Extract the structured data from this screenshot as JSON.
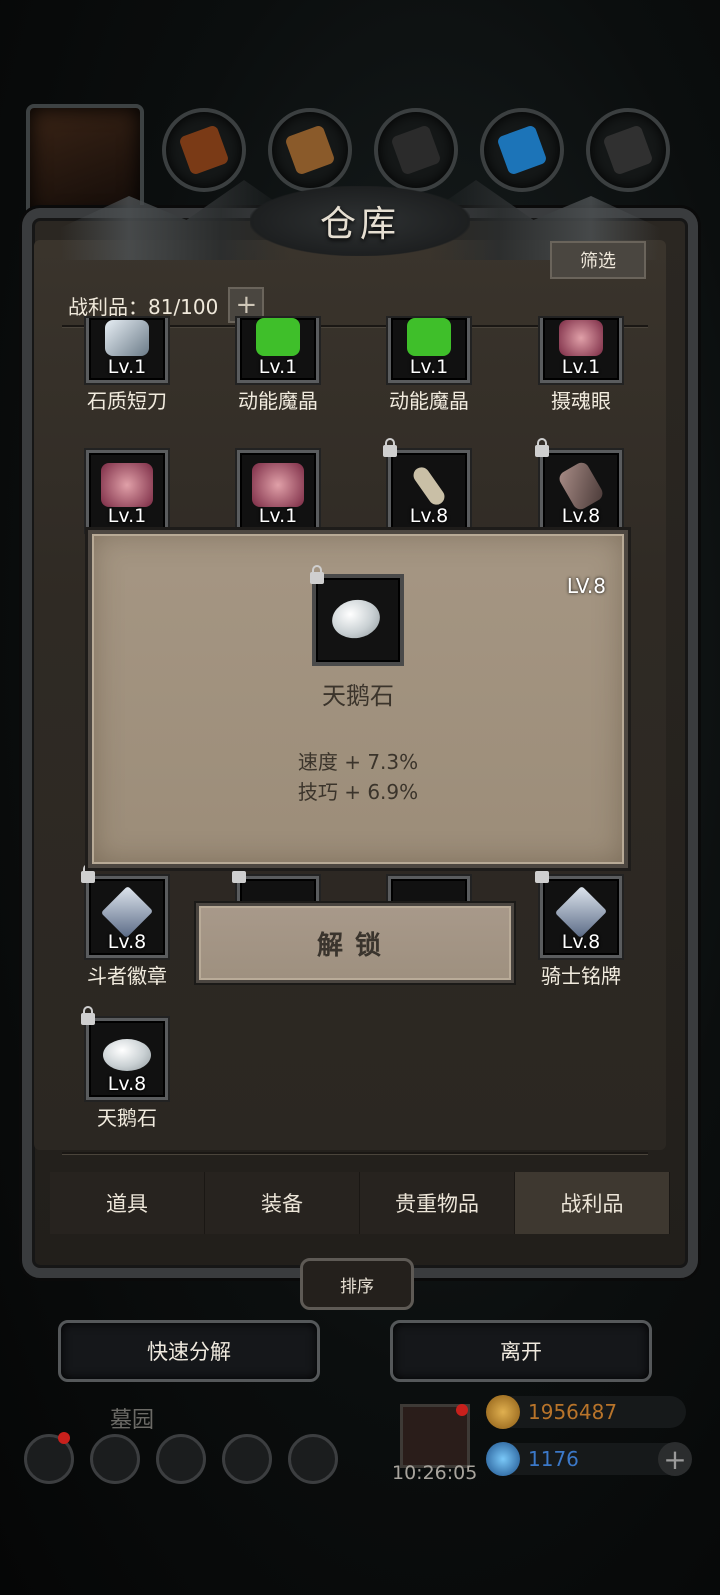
{
  "window": {
    "title": "仓库"
  },
  "header": {
    "filter_label": "筛选",
    "loot_label": "战利品：81/100",
    "plus_symbol": "+"
  },
  "grid": {
    "row1": [
      {
        "level": "Lv.1",
        "name": "石质短刀",
        "locked": false,
        "icon": "blade-icon"
      },
      {
        "level": "Lv.1",
        "name": "动能魔晶",
        "locked": false,
        "icon": "green-crystal-icon"
      },
      {
        "level": "Lv.1",
        "name": "动能魔晶",
        "locked": false,
        "icon": "green-crystal-icon"
      },
      {
        "level": "Lv.1",
        "name": "摄魂眼",
        "locked": false,
        "icon": "eye-icon"
      }
    ],
    "row2": [
      {
        "level": "Lv.1",
        "locked": false,
        "icon": "eye-icon"
      },
      {
        "level": "Lv.1",
        "locked": false,
        "icon": "eye-icon"
      },
      {
        "level": "Lv.8",
        "locked": true,
        "icon": "bone-icon"
      },
      {
        "level": "Lv.8",
        "locked": true,
        "icon": "shard-icon"
      }
    ],
    "row5": [
      {
        "level": "Lv.8",
        "name": "斗者徽章",
        "locked": true,
        "icon": "badge-icon"
      },
      {
        "level": "Lv.8",
        "name": "骑士铭牌",
        "locked": true,
        "icon": "badge-icon"
      }
    ],
    "row6": [
      {
        "level": "Lv.8",
        "name": "天鹅石",
        "locked": true,
        "icon": "stone-icon"
      }
    ]
  },
  "popup": {
    "level": "LV.8",
    "name": "天鹅石",
    "stats": [
      "速度 + 7.3%",
      "技巧 + 6.9%"
    ],
    "unlock_label": "解锁"
  },
  "tabs": [
    {
      "label": "道具",
      "active": false
    },
    {
      "label": "装备",
      "active": false
    },
    {
      "label": "贵重物品",
      "active": false
    },
    {
      "label": "战利品",
      "active": true
    }
  ],
  "actions": {
    "sort_label": "排序",
    "quick_dismantle_label": "快速分解",
    "leave_label": "离开"
  },
  "hud": {
    "location": "墓园",
    "time": "10:26:05",
    "gold": "1956487",
    "gems": "1176",
    "plus_symbol": "+"
  },
  "colors": {
    "gold_text": "#b8742a",
    "gem_text": "#3b78c8",
    "alert_red": "#c8201c"
  }
}
